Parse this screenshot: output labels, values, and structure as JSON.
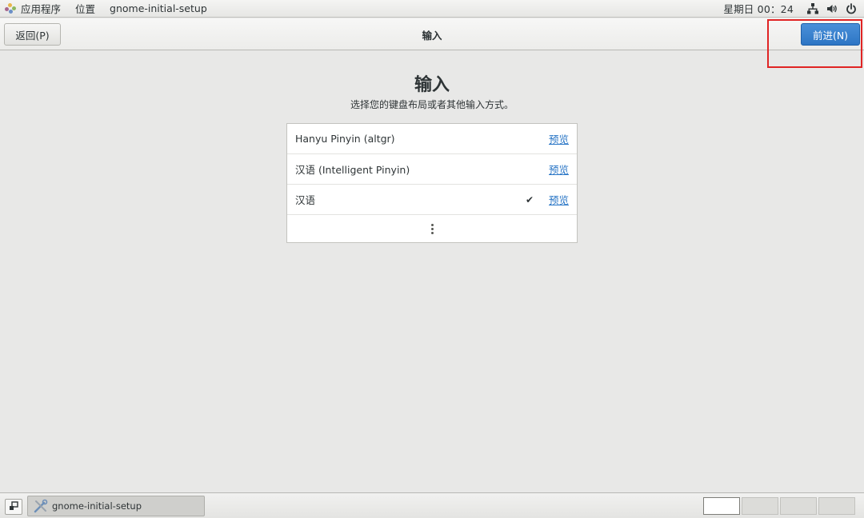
{
  "top_panel": {
    "applications_label": "应用程序",
    "places_label": "位置",
    "window_title": "gnome-initial-setup",
    "clock": "星期日 00：24",
    "icons": [
      "network-icon",
      "volume-icon",
      "power-icon"
    ]
  },
  "header": {
    "back_label": "返回(P)",
    "title": "输入",
    "next_label": "前进(N)",
    "next_color": "#3584e4"
  },
  "main": {
    "heading": "输入",
    "subtitle": "选择您的键盘布局或者其他输入方式。",
    "sources": [
      {
        "label": "Hanyu Pinyin (altgr)",
        "selected": false,
        "preview_label": "预览"
      },
      {
        "label": "汉语 (Intelligent Pinyin)",
        "selected": false,
        "preview_label": "预览"
      },
      {
        "label": "汉语",
        "selected": true,
        "check": "✔",
        "preview_label": "预览"
      }
    ],
    "more_icon": "view-more-icon"
  },
  "taskbar": {
    "task_label": "gnome-initial-setup",
    "workspaces": 4,
    "active_workspace": 1
  }
}
